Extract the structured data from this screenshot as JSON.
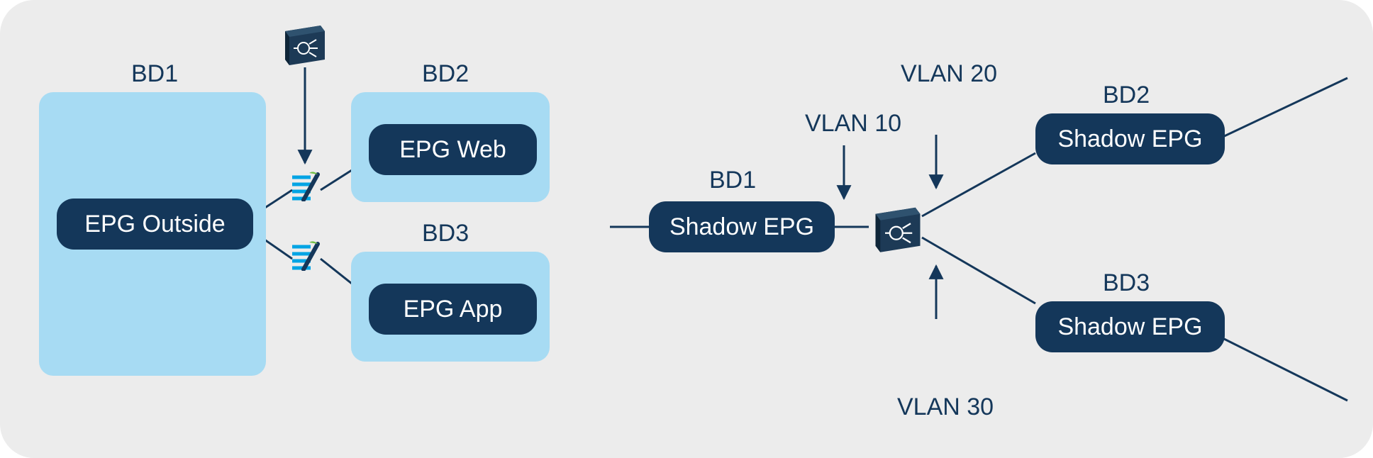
{
  "left": {
    "bd1": {
      "label": "BD1",
      "epg": "EPG Outside"
    },
    "bd2": {
      "label": "BD2",
      "epg": "EPG Web"
    },
    "bd3": {
      "label": "BD3",
      "epg": "EPG App"
    }
  },
  "right": {
    "bd1": {
      "label": "BD1",
      "epg": "Shadow EPG"
    },
    "bd2": {
      "label": "BD2",
      "epg": "Shadow EPG"
    },
    "bd3": {
      "label": "BD3",
      "epg": "Shadow EPG"
    },
    "vlan10": "VLAN 10",
    "vlan20": "VLAN 20",
    "vlan30": "VLAN 30"
  }
}
